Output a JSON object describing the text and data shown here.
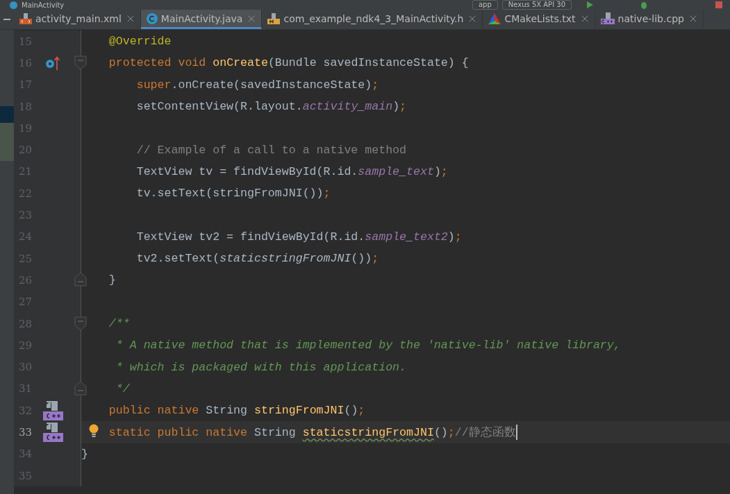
{
  "title_bar": {
    "title": "MainActivity",
    "module": "app",
    "device": "Nexus 5X API 30"
  },
  "tabs": [
    {
      "label": "activity_main.xml",
      "selected": false
    },
    {
      "label": "MainActivity.java",
      "selected": true
    },
    {
      "label": "com_example_ndk4_3_MainActivity.h",
      "selected": false
    },
    {
      "label": "CMakeLists.txt",
      "selected": false
    },
    {
      "label": "native-lib.cpp",
      "selected": false
    }
  ],
  "lines": [
    {
      "number": "15",
      "current": false,
      "tokens": [
        {
          "kind": "annotation",
          "text": "    @Override"
        }
      ]
    },
    {
      "number": "16",
      "current": false,
      "tokens": [
        {
          "kind": "keyword",
          "text": "    protected void "
        },
        {
          "kind": "declaration",
          "text": "onCreate"
        },
        {
          "kind": "plain",
          "text": "(Bundle savedInstanceState) {"
        }
      ]
    },
    {
      "number": "17",
      "current": false,
      "tokens": [
        {
          "kind": "keyword",
          "text": "        super"
        },
        {
          "kind": "plain",
          "text": ".onCreate(savedInstanceState)"
        },
        {
          "kind": "keyword",
          "text": ";"
        }
      ]
    },
    {
      "number": "18",
      "current": false,
      "tokens": [
        {
          "kind": "plain",
          "text": "        setContentView(R.layout."
        },
        {
          "kind": "field",
          "text": "activity_main"
        },
        {
          "kind": "plain",
          "text": ")"
        },
        {
          "kind": "keyword",
          "text": ";"
        }
      ]
    },
    {
      "number": "19",
      "current": false
    },
    {
      "number": "20",
      "current": false,
      "tokens": [
        {
          "kind": "comment",
          "text": "        // Example of a call to a native method"
        }
      ]
    },
    {
      "number": "21",
      "current": false,
      "tokens": [
        {
          "kind": "plain",
          "text": "        TextView tv = findViewById(R.id."
        },
        {
          "kind": "field",
          "text": "sample_text"
        },
        {
          "kind": "plain",
          "text": ")"
        },
        {
          "kind": "keyword",
          "text": ";"
        }
      ]
    },
    {
      "number": "22",
      "current": false,
      "tokens": [
        {
          "kind": "plain",
          "text": "        tv.setText(stringFromJNI())"
        },
        {
          "kind": "keyword",
          "text": ";"
        }
      ]
    },
    {
      "number": "23",
      "current": false
    },
    {
      "number": "24",
      "current": false,
      "tokens": [
        {
          "kind": "plain",
          "text": "        TextView tv2 = findViewById(R.id."
        },
        {
          "kind": "field",
          "text": "sample_text2"
        },
        {
          "kind": "plain",
          "text": ")"
        },
        {
          "kind": "keyword",
          "text": ";"
        }
      ]
    },
    {
      "number": "25",
      "current": false,
      "tokens": [
        {
          "kind": "plain",
          "text": "        tv2.setText("
        },
        {
          "kind": "static",
          "text": "staticstringFromJNI"
        },
        {
          "kind": "plain",
          "text": "())"
        },
        {
          "kind": "keyword",
          "text": ";"
        }
      ]
    },
    {
      "number": "26",
      "current": false,
      "tokens": [
        {
          "kind": "plain",
          "text": "    }"
        }
      ]
    },
    {
      "number": "27",
      "current": false
    },
    {
      "number": "28",
      "current": false,
      "tokens": [
        {
          "kind": "doc",
          "text": "    /**"
        }
      ]
    },
    {
      "number": "29",
      "current": false,
      "tokens": [
        {
          "kind": "doc",
          "text": "     * A native method that is implemented by the 'native-lib' native library,"
        }
      ]
    },
    {
      "number": "30",
      "current": false,
      "tokens": [
        {
          "kind": "doc",
          "text": "     * which is packaged with this application."
        }
      ]
    },
    {
      "number": "31",
      "current": false,
      "tokens": [
        {
          "kind": "doc",
          "text": "     */"
        }
      ]
    },
    {
      "number": "32",
      "current": false,
      "tokens": [
        {
          "kind": "keyword",
          "text": "    public native "
        },
        {
          "kind": "plain",
          "text": "String "
        },
        {
          "kind": "declaration",
          "text": "stringFromJNI"
        },
        {
          "kind": "plain",
          "text": "()"
        },
        {
          "kind": "keyword",
          "text": ";"
        }
      ]
    },
    {
      "number": "33",
      "current": true,
      "bulb": true,
      "tokens": [
        {
          "kind": "keyword",
          "text": "    static public native "
        },
        {
          "kind": "plain",
          "text": "String "
        },
        {
          "kind": "warning",
          "text": "staticstringFromJNI"
        },
        {
          "kind": "plain",
          "text": "()"
        },
        {
          "kind": "keyword",
          "text": ";"
        },
        {
          "kind": "comment",
          "text": "//静态函数"
        }
      ]
    },
    {
      "number": "34",
      "current": false,
      "tokens": [
        {
          "kind": "plain",
          "text": "}"
        }
      ]
    },
    {
      "number": "35",
      "current": false
    }
  ]
}
